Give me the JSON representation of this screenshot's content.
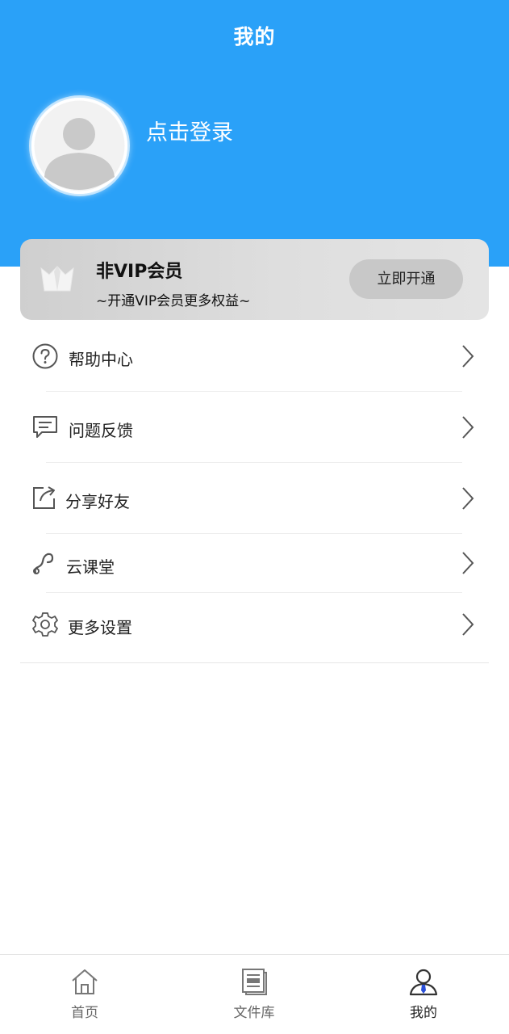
{
  "header": {
    "title": "我的",
    "bg_color": "#2aa1f8"
  },
  "profile": {
    "login_text": "点击登录",
    "avatar_icon": "user-avatar-placeholder"
  },
  "vip": {
    "title": "非VIP会员",
    "subtitle": "~开通VIP会员更多权益~",
    "button_label": "立即开通",
    "icon": "crown-icon"
  },
  "menu": {
    "items": [
      {
        "label": "帮助中心",
        "icon": "help-circle-icon"
      },
      {
        "label": "问题反馈",
        "icon": "message-icon"
      },
      {
        "label": "分享好友",
        "icon": "share-icon"
      },
      {
        "label": "云课堂",
        "icon": "link-icon"
      },
      {
        "label": "更多设置",
        "icon": "gear-icon"
      }
    ]
  },
  "tabbar": {
    "tabs": [
      {
        "label": "首页",
        "icon": "home-icon",
        "active": false
      },
      {
        "label": "文件库",
        "icon": "document-icon",
        "active": false
      },
      {
        "label": "我的",
        "icon": "user-icon",
        "active": true
      }
    ],
    "active_color": "#2a4fd8"
  }
}
